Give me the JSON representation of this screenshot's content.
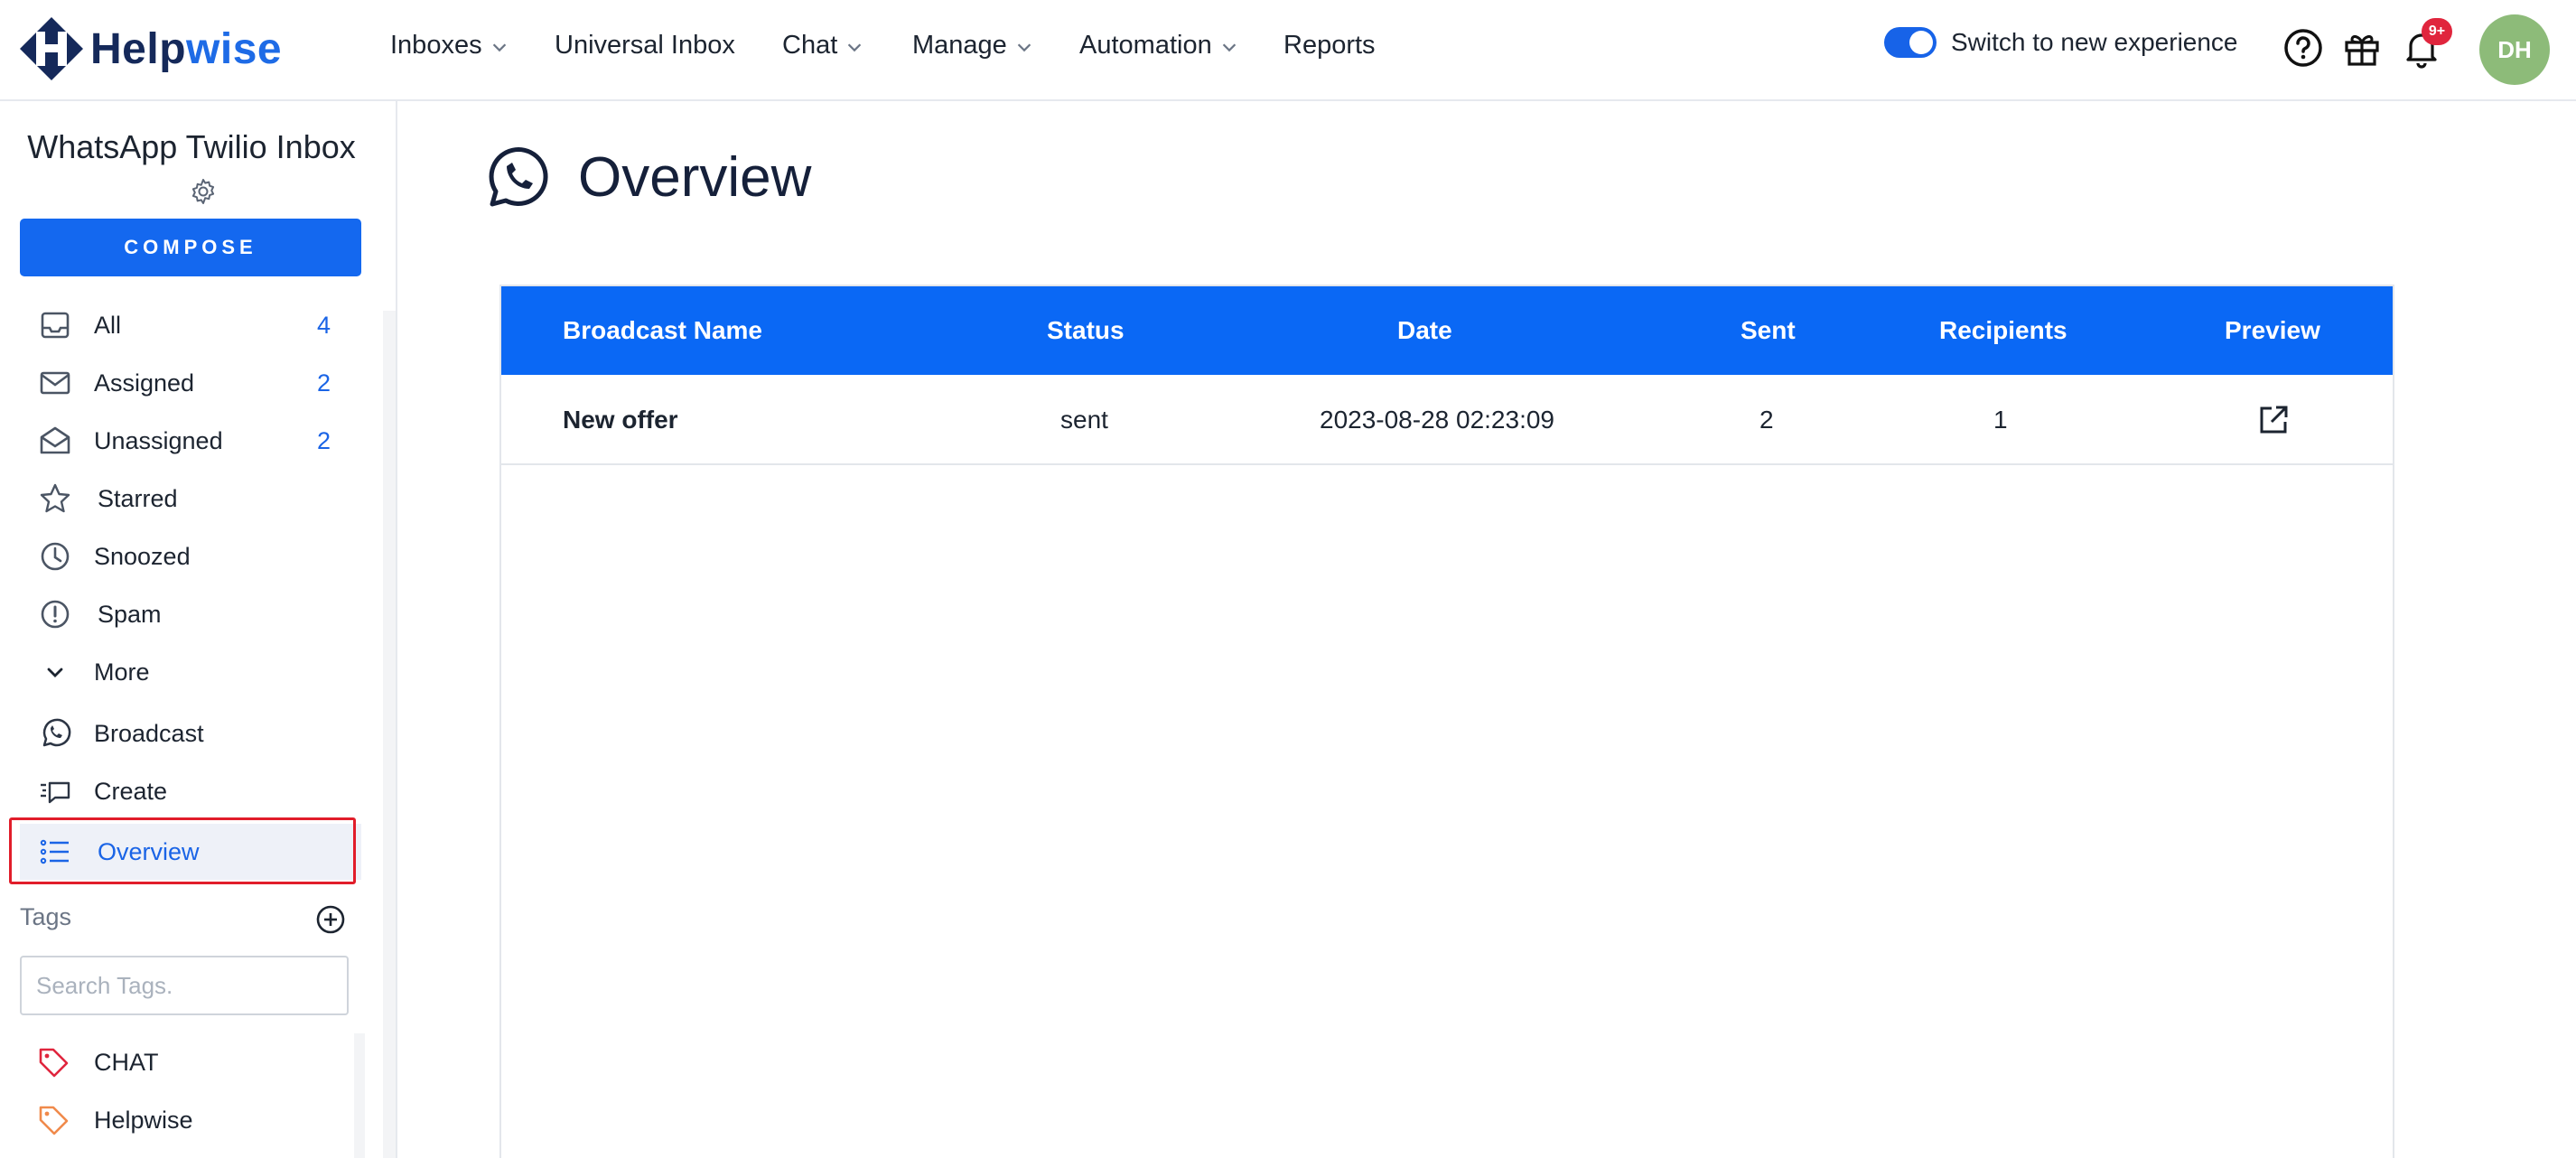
{
  "brand": {
    "name_part1": "Help",
    "name_part2": "wise",
    "color_dark": "#15295a",
    "color_accent": "#1e6be6"
  },
  "topnav": {
    "items": [
      {
        "label": "Inboxes",
        "dropdown": true
      },
      {
        "label": "Universal Inbox",
        "dropdown": false
      },
      {
        "label": "Chat",
        "dropdown": true
      },
      {
        "label": "Manage",
        "dropdown": true
      },
      {
        "label": "Automation",
        "dropdown": true
      },
      {
        "label": "Reports",
        "dropdown": false
      }
    ],
    "toggle_label": "Switch to new experience",
    "toggle_on": true,
    "notification_badge": "9+",
    "avatar_initials": "DH",
    "icons": [
      "help-icon",
      "gift-icon",
      "bell-icon"
    ]
  },
  "sidebar": {
    "inbox_title": "WhatsApp Twilio Inbox",
    "compose_label": "COMPOSE",
    "items": [
      {
        "label": "All",
        "count": "4",
        "icon": "inbox-icon"
      },
      {
        "label": "Assigned",
        "count": "2",
        "icon": "mail-icon"
      },
      {
        "label": "Unassigned",
        "count": "2",
        "icon": "mail-open-icon"
      },
      {
        "label": "Starred",
        "count": "",
        "icon": "star-icon"
      },
      {
        "label": "Snoozed",
        "count": "",
        "icon": "clock-icon"
      },
      {
        "label": "Spam",
        "count": "",
        "icon": "alert-circle-icon"
      },
      {
        "label": "More",
        "count": "",
        "icon": "chevron-down-icon"
      },
      {
        "label": "Broadcast",
        "count": "",
        "icon": "whatsapp-icon"
      },
      {
        "label": "Create",
        "count": "",
        "icon": "create-broadcast-icon"
      },
      {
        "label": "Overview",
        "count": "",
        "icon": "list-icon",
        "active": true
      }
    ],
    "tags_label": "Tags",
    "tag_search_placeholder": "Search Tags.",
    "tags": [
      {
        "label": "CHAT",
        "color": "#e0253d"
      },
      {
        "label": "Helpwise",
        "color": "#f08a4b"
      }
    ]
  },
  "main": {
    "title": "Overview",
    "table": {
      "columns": [
        "Broadcast Name",
        "Status",
        "Date",
        "Sent",
        "Recipients",
        "Preview"
      ],
      "rows": [
        {
          "name": "New offer",
          "status": "sent",
          "date": "2023-08-28 02:23:09",
          "sent": "2",
          "recipients": "1"
        }
      ],
      "header_color": "#0a68f5"
    }
  }
}
